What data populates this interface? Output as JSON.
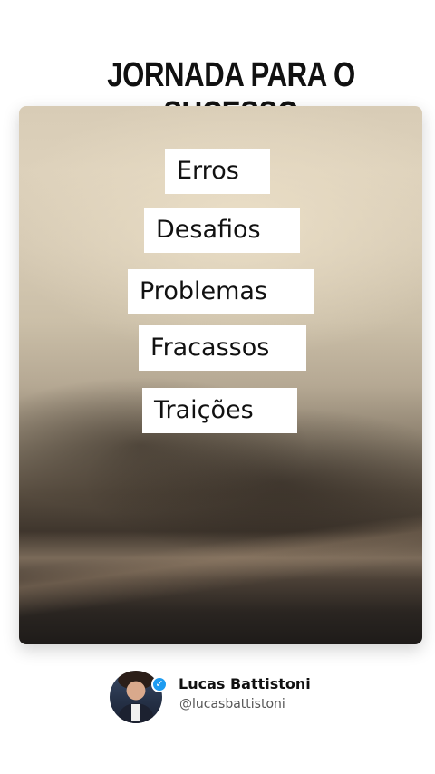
{
  "post": {
    "title": "JORNADA PARA O SUCESSO",
    "tags": [
      "Erros",
      "Desafios",
      "Problemas",
      "Fracassos",
      "Traições"
    ]
  },
  "author": {
    "name": "Lucas Battistoni",
    "handle": "@lucasbattistoni",
    "verified_icon": "verified-check-icon",
    "verified_color": "#1d9bf0"
  }
}
